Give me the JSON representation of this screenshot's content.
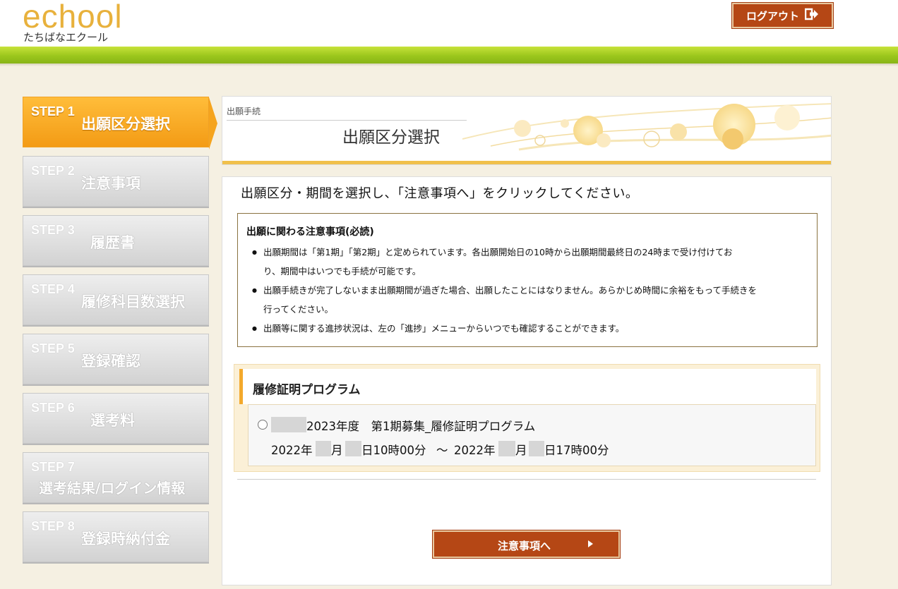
{
  "header": {
    "logo_main": "echool",
    "logo_sub": "たちばなエクール",
    "logout_label": "ログアウト"
  },
  "steps": [
    {
      "num": "STEP 1",
      "label": "出願区分選択",
      "active": true
    },
    {
      "num": "STEP 2",
      "label": "注意事項"
    },
    {
      "num": "STEP 3",
      "label": "履歴書"
    },
    {
      "num": "STEP 4",
      "label": "履修科目数選択"
    },
    {
      "num": "STEP 5",
      "label": "登録確認"
    },
    {
      "num": "STEP 6",
      "label": "選考料"
    },
    {
      "num": "STEP 7",
      "label": "選考結果/ログイン情報"
    },
    {
      "num": "STEP 8",
      "label": "登録時納付金"
    }
  ],
  "title_panel": {
    "breadcrumb": "出願手続",
    "title": "出願区分選択"
  },
  "main": {
    "instruction": "出願区分・期間を選択し、「注意事項へ」をクリックしてください。",
    "notice": {
      "title": "出願に関わる注意事項(必読)",
      "items": [
        "出願期間は「第1期」「第2期」と定められています。各出願開始日の10時から出願期間最終日の24時まで受け付けてお",
        "り、期間中はいつでも手続が可能です。",
        "出願手続きが完了しないまま出願期間が過ぎた場合、出願したことにはなりません。あらかじめ時間に余裕をもって手続きを",
        "行ってください。",
        "出願等に関する進捗状況は、左の「進捗」メニューからいつでも確認することができます。"
      ]
    },
    "program": {
      "heading": "履修証明プログラム",
      "option_label": "2023年度　第1期募集_履修証明プログラム",
      "period": {
        "start_year": "2022年",
        "month_unit": "月",
        "start_day_time": "日10時00分",
        "separator": "～",
        "end_year": "2022年",
        "end_day_time": "日17時00分"
      }
    },
    "next_button": "注意事項へ"
  },
  "colors": {
    "accent_orange": "#f39b15",
    "button_brown": "#b54715",
    "green_bar": "#9bc71c",
    "logo": "#e8b13c"
  }
}
